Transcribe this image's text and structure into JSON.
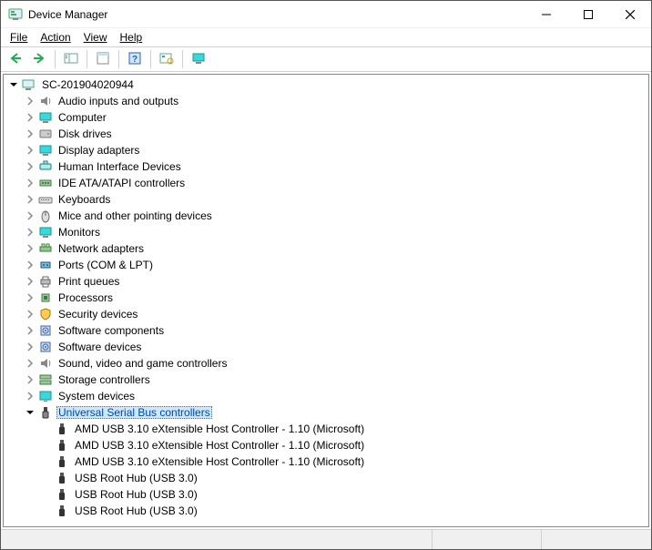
{
  "window": {
    "title": "Device Manager"
  },
  "menu": {
    "file": "File",
    "action": "Action",
    "view": "View",
    "help": "Help"
  },
  "tree": {
    "root": {
      "label": "SC-201904020944",
      "expanded": true,
      "icon": "computer"
    },
    "categories": [
      {
        "label": "Audio inputs and outputs",
        "icon": "audio",
        "expanded": false
      },
      {
        "label": "Computer",
        "icon": "monitor",
        "expanded": false
      },
      {
        "label": "Disk drives",
        "icon": "disk",
        "expanded": false
      },
      {
        "label": "Display adapters",
        "icon": "monitor",
        "expanded": false
      },
      {
        "label": "Human Interface Devices",
        "icon": "hid",
        "expanded": false
      },
      {
        "label": "IDE ATA/ATAPI controllers",
        "icon": "ide",
        "expanded": false
      },
      {
        "label": "Keyboards",
        "icon": "keyboard",
        "expanded": false
      },
      {
        "label": "Mice and other pointing devices",
        "icon": "mouse",
        "expanded": false
      },
      {
        "label": "Monitors",
        "icon": "monitor",
        "expanded": false
      },
      {
        "label": "Network adapters",
        "icon": "network",
        "expanded": false
      },
      {
        "label": "Ports (COM & LPT)",
        "icon": "port",
        "expanded": false
      },
      {
        "label": "Print queues",
        "icon": "printer",
        "expanded": false
      },
      {
        "label": "Processors",
        "icon": "cpu",
        "expanded": false
      },
      {
        "label": "Security devices",
        "icon": "security",
        "expanded": false
      },
      {
        "label": "Software components",
        "icon": "software",
        "expanded": false
      },
      {
        "label": "Software devices",
        "icon": "software",
        "expanded": false
      },
      {
        "label": "Sound, video and game controllers",
        "icon": "audio",
        "expanded": false
      },
      {
        "label": "Storage controllers",
        "icon": "storage",
        "expanded": false
      },
      {
        "label": "System devices",
        "icon": "system",
        "expanded": false
      },
      {
        "label": "Universal Serial Bus controllers",
        "icon": "usb",
        "expanded": true,
        "selected": true,
        "children": [
          {
            "label": "AMD USB 3.10 eXtensible Host Controller - 1.10 (Microsoft)",
            "icon": "usbdev"
          },
          {
            "label": "AMD USB 3.10 eXtensible Host Controller - 1.10 (Microsoft)",
            "icon": "usbdev"
          },
          {
            "label": "AMD USB 3.10 eXtensible Host Controller - 1.10 (Microsoft)",
            "icon": "usbdev"
          },
          {
            "label": "USB Root Hub (USB 3.0)",
            "icon": "usbdev"
          },
          {
            "label": "USB Root Hub (USB 3.0)",
            "icon": "usbdev"
          },
          {
            "label": "USB Root Hub (USB 3.0)",
            "icon": "usbdev"
          }
        ]
      }
    ]
  }
}
